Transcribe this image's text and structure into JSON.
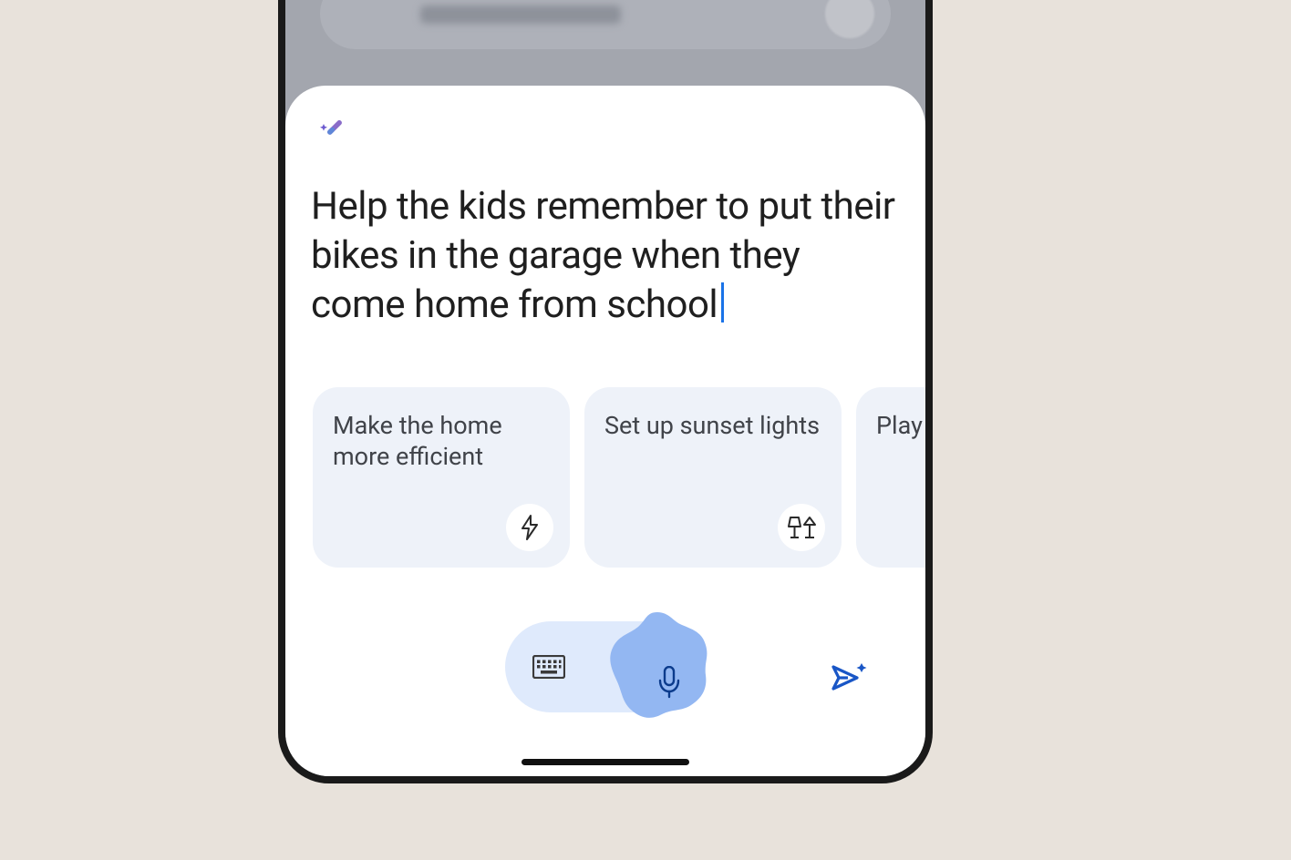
{
  "prompt_text": "Help the kids remember to put their bikes in the garage when they come home from school",
  "suggestions": [
    {
      "label": "Make the home more efficient",
      "icon": "bolt-icon"
    },
    {
      "label": "Set up sunset lights",
      "icon": "lamp-icon"
    },
    {
      "label": "Play s when",
      "icon": ""
    }
  ],
  "icons": {
    "magic": "magic-wand-icon",
    "keyboard": "keyboard-icon",
    "mic": "mic-icon",
    "send": "send-icon"
  }
}
